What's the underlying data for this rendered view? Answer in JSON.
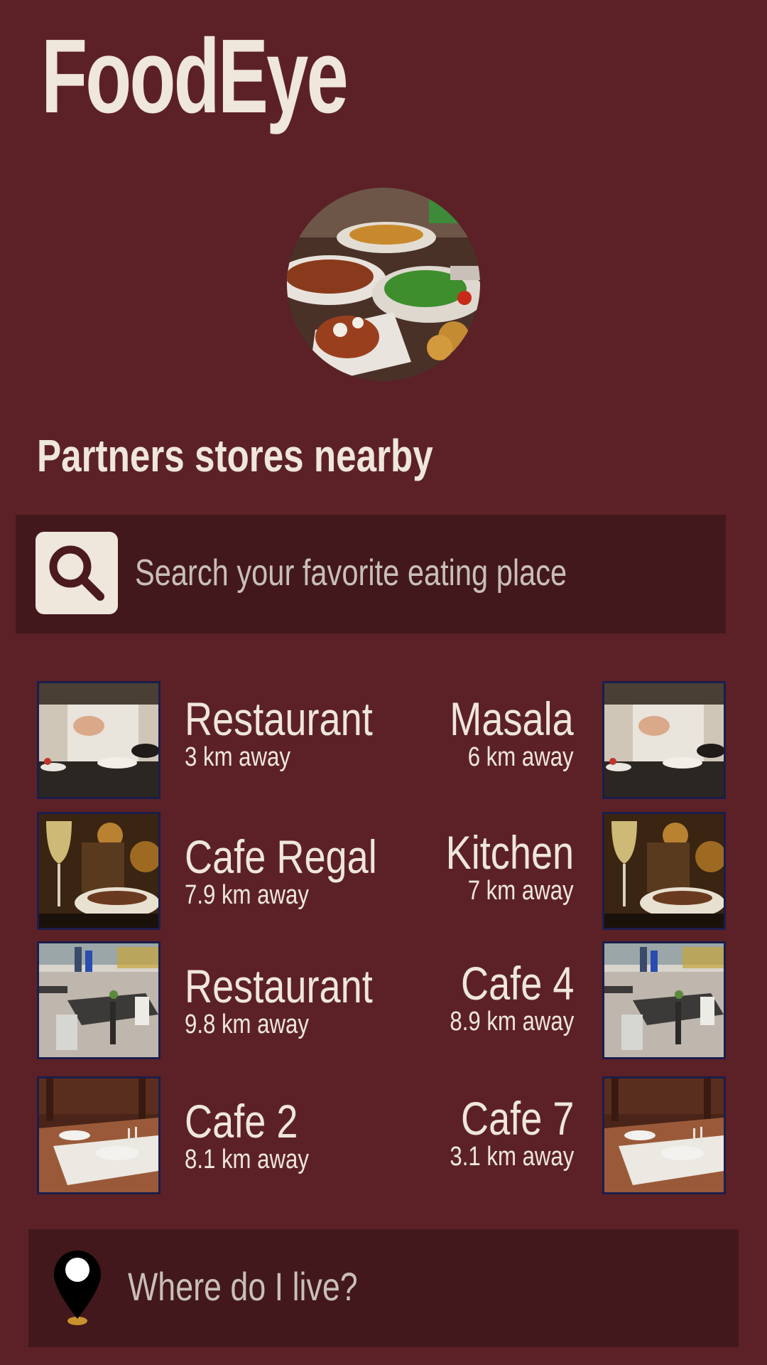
{
  "app": {
    "title": "FoodEye"
  },
  "section_title": "Partners stores nearby",
  "search": {
    "placeholder": "Search your favorite eating place",
    "value": ""
  },
  "stores": [
    {
      "name": "Restaurant",
      "distance": "3 km away",
      "photo": "chef-cooking"
    },
    {
      "name": "Masala",
      "distance": "6 km away",
      "photo": "chef-cooking"
    },
    {
      "name": "Cafe Regal",
      "distance": "7.9 km away",
      "photo": "wine-and-dish"
    },
    {
      "name": "Kitchen",
      "distance": "7 km away",
      "photo": "wine-and-dish"
    },
    {
      "name": "Restaurant",
      "distance": "9.8 km away",
      "photo": "street-terrace"
    },
    {
      "name": "Cafe 4",
      "distance": "8.9 km away",
      "photo": "street-terrace"
    },
    {
      "name": "Cafe 2",
      "distance": "8.1 km away",
      "photo": "set-dining-table"
    },
    {
      "name": "Cafe 7",
      "distance": "3.1 km away",
      "photo": "set-dining-table"
    }
  ],
  "location": {
    "label": "Where do I live?"
  },
  "colors": {
    "background": "#5c2126",
    "panel": "#42181c",
    "text": "#efe6dc",
    "muted_text": "#c9bfb8",
    "thumb_border": "#1b1d4a"
  }
}
